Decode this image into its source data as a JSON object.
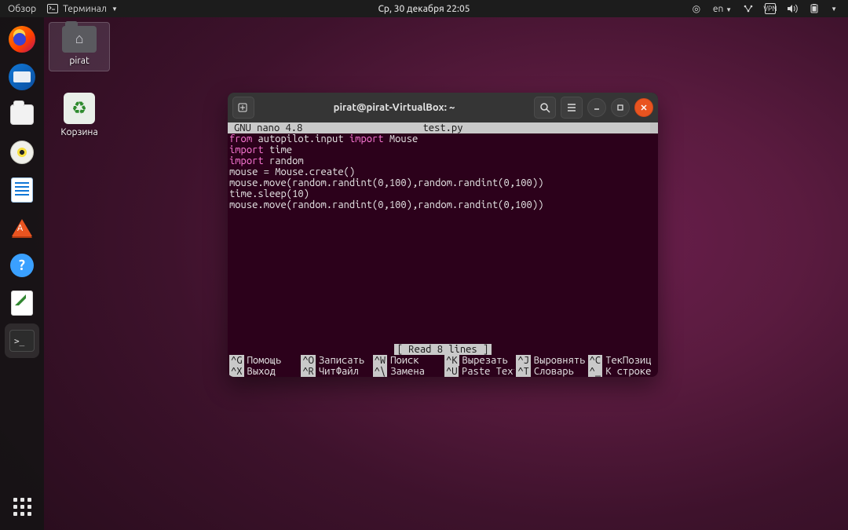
{
  "panel": {
    "activities": "Обзор",
    "app_menu": "Терминал",
    "clock": "Ср, 30 декабря  22:05",
    "lang": "en"
  },
  "desktop": {
    "home_label": "pirat",
    "trash_label": "Корзина"
  },
  "dock": {
    "items": [
      "firefox",
      "thunderbird",
      "files",
      "rhythmbox",
      "writer",
      "software",
      "help",
      "text-editor",
      "terminal"
    ]
  },
  "terminal": {
    "title": "pirat@pirat-VirtualBox: ~",
    "nano": {
      "app": "GNU nano 4.8",
      "filename": "test.py",
      "status": "[ Read 8 lines ]",
      "code": [
        {
          "t": "from ",
          "c": "kw-from"
        },
        {
          "t": "autopilot.input "
        },
        {
          "t": "import ",
          "c": "kw-import"
        },
        {
          "t": "Mouse\n"
        },
        {
          "t": "import ",
          "c": "kw-import"
        },
        {
          "t": "time\n"
        },
        {
          "t": "import ",
          "c": "kw-import"
        },
        {
          "t": "random\n"
        },
        {
          "t": "mouse = Mouse.create()\n"
        },
        {
          "t": "mouse.move(random.randint(0,100),random.randint(0,100))\n"
        },
        {
          "t": "time.sleep(10)\n"
        },
        {
          "t": "mouse.move(random.randint(0,100),random.randint(0,100))\n"
        }
      ],
      "shortcuts_row1": [
        {
          "k": "^G",
          "l": "Помощь"
        },
        {
          "k": "^O",
          "l": "Записать"
        },
        {
          "k": "^W",
          "l": "Поиск"
        },
        {
          "k": "^K",
          "l": "Вырезать"
        },
        {
          "k": "^J",
          "l": "Выровнять"
        },
        {
          "k": "^C",
          "l": "ТекПозиц"
        }
      ],
      "shortcuts_row2": [
        {
          "k": "^X",
          "l": "Выход"
        },
        {
          "k": "^R",
          "l": "ЧитФайл"
        },
        {
          "k": "^\\",
          "l": "Замена"
        },
        {
          "k": "^U",
          "l": "Paste Text"
        },
        {
          "k": "^T",
          "l": "Словарь"
        },
        {
          "k": "^_",
          "l": "К строке"
        }
      ]
    }
  }
}
